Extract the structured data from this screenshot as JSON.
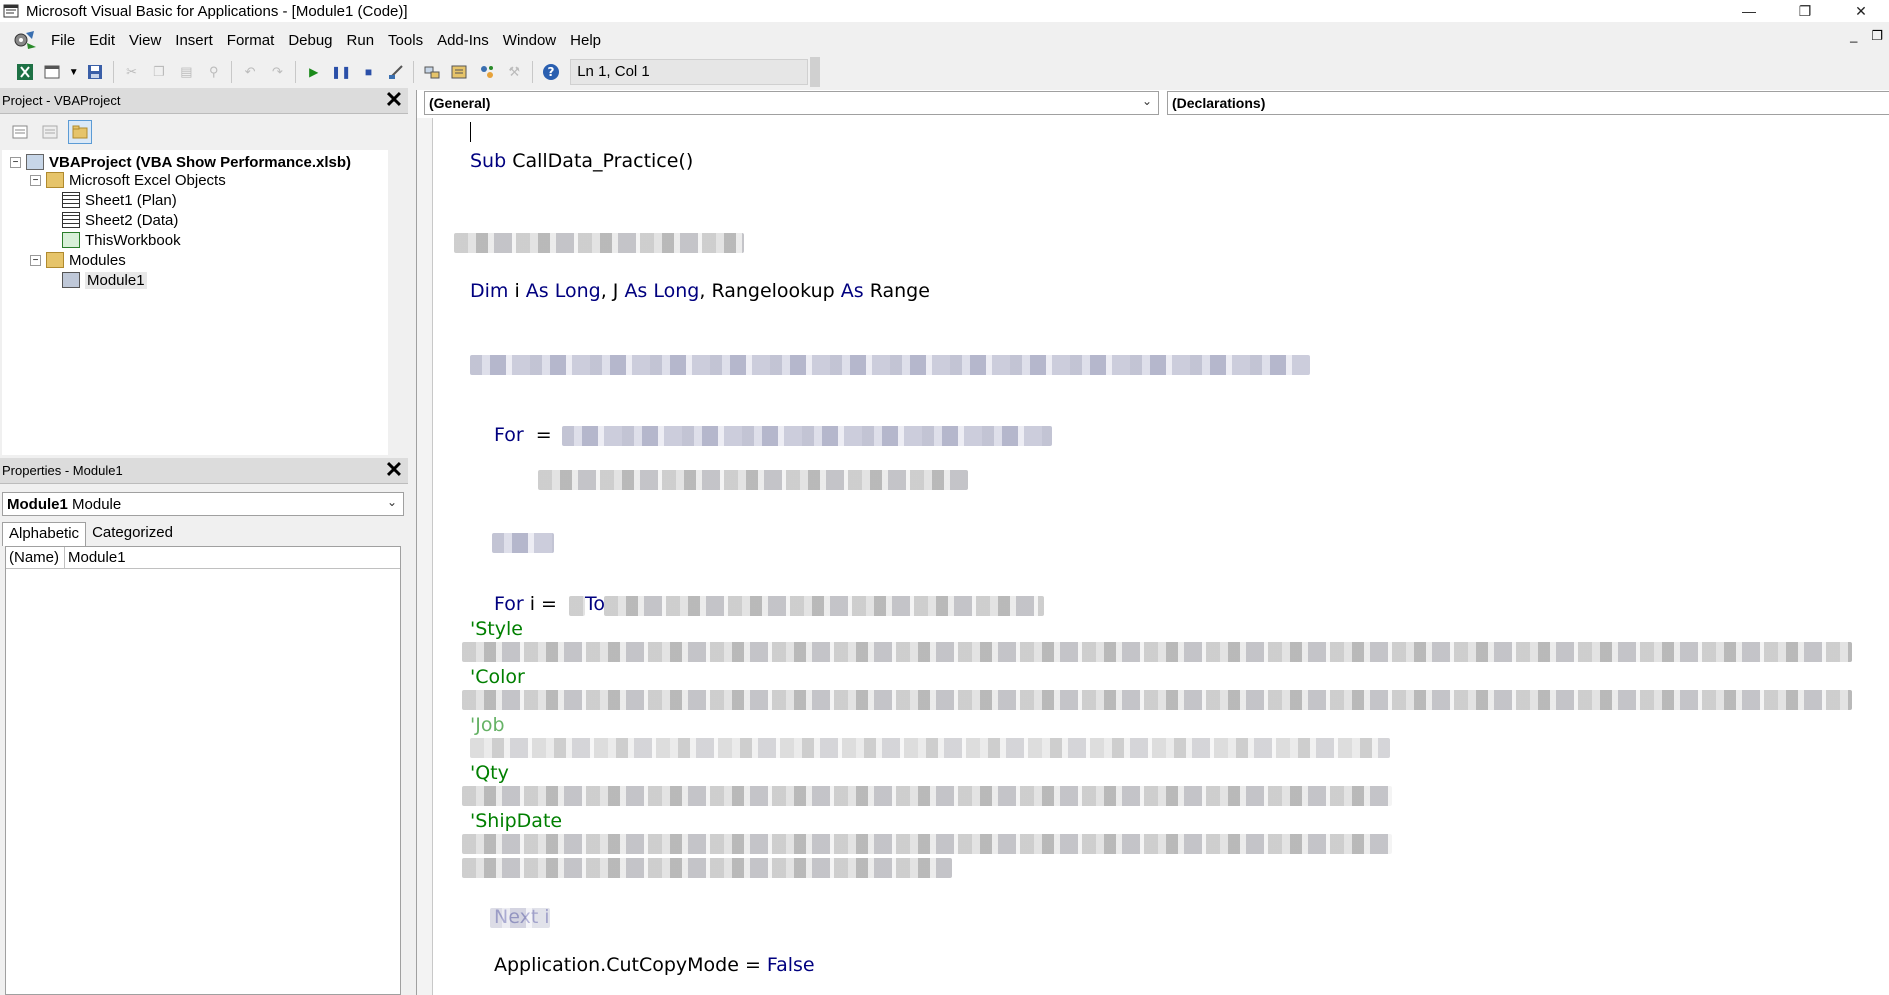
{
  "window": {
    "title": "Microsoft Visual Basic for Applications - [Module1 (Code)]",
    "controls": {
      "minimize": "—",
      "restore": "❐",
      "close": "✕"
    },
    "mdi_controls": {
      "minimize": "_",
      "restore": "❐"
    }
  },
  "menu": [
    "File",
    "Edit",
    "View",
    "Insert",
    "Format",
    "Debug",
    "Run",
    "Tools",
    "Add-Ins",
    "Window",
    "Help"
  ],
  "toolbar": {
    "status": "Ln 1, Col 1",
    "icons": [
      "excel-view-icon",
      "insert-module-icon",
      "save-icon",
      "cut-icon",
      "copy-icon",
      "paste-icon",
      "find-icon",
      "undo-icon",
      "redo-icon",
      "run-icon",
      "break-icon",
      "reset-icon",
      "design-mode-icon",
      "project-explorer-icon",
      "properties-icon",
      "object-browser-icon",
      "toolbox-icon",
      "help-icon"
    ]
  },
  "project_pane": {
    "title": "Project - VBAProject",
    "tree": {
      "root": "VBAProject (VBA Show Performance.xlsb)",
      "excel_objects_folder": "Microsoft Excel Objects",
      "sheet1": "Sheet1 (Plan)",
      "sheet2": "Sheet2 (Data)",
      "workbook": "ThisWorkbook",
      "modules_folder": "Modules",
      "module1": "Module1"
    }
  },
  "properties_pane": {
    "title": "Properties - Module1",
    "object_name": "Module1",
    "object_type": "Module",
    "tabs": [
      "Alphabetic",
      "Categorized"
    ],
    "rows": [
      {
        "name": "(Name)",
        "value": "Module1"
      }
    ]
  },
  "code_window": {
    "object_combo": "(General)",
    "procedure_combo": "(Declarations)",
    "code": {
      "sub_kw": "Sub",
      "sub_name": " CallData_Practice()",
      "dim_kw": "Dim",
      "dim_i": " i ",
      "as_long_1": "As Long",
      "dim_j": ", J ",
      "as_long_2": "As Long",
      "dim_range_var": ", Rangelookup ",
      "as_kw": "As",
      "range_type": " Range",
      "for1_kw": "For",
      "for1_eq": "  = ",
      "for2_kw": "For",
      "for2_i": " i = ",
      "to_kw": "To",
      "comment_style": "'Style",
      "comment_color": "'Color",
      "comment_job": "'Job",
      "comment_qty": "'Qty",
      "comment_shipdate": "'ShipDate",
      "next_kw": "Next i",
      "cutcopy": "Application.CutCopyMode = ",
      "false_kw": "False"
    }
  }
}
